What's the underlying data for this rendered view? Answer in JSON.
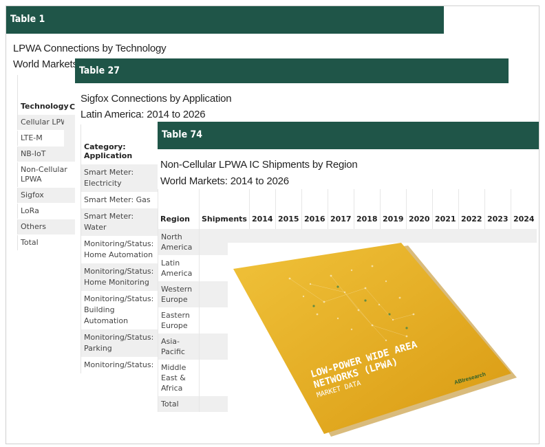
{
  "table1": {
    "label": "Table 1",
    "subtitle_line1": "LPWA Connections by Technology",
    "subtitle_line2": "World Markets",
    "header_col1": "Technology",
    "header_col2": "C",
    "rows": [
      "Cellular LPWA",
      "LTE-M",
      "NB-IoT",
      "Non-Cellular LPWA",
      "Sigfox",
      "LoRa",
      "Others",
      "Total"
    ]
  },
  "table27": {
    "label": "Table 27",
    "subtitle_line1": "Sigfox Connections by Application",
    "subtitle_line2": "Latin America: 2014 to 2026",
    "header": "Category: Application",
    "rows": [
      "Smart Meter: Electricity",
      "Smart Meter: Gas",
      "Smart Meter: Water",
      "Monitoring/Status: Home Automation",
      "Monitoring/Status: Home Monitoring",
      "Monitoring/Status: Building Automation",
      "Monitoring/Status: Parking",
      "Monitoring/Status:"
    ]
  },
  "table74": {
    "label": "Table 74",
    "subtitle_line1": "Non-Cellular LPWA IC Shipments by Region",
    "subtitle_line2": "World Markets: 2014 to 2026",
    "headers": [
      "Region",
      "Shipments",
      "2014",
      "2015",
      "2016",
      "2017",
      "2018",
      "2019",
      "2020",
      "2021",
      "2022",
      "2023",
      "2024"
    ],
    "rows": [
      "North America",
      "Latin America",
      "Western Europe",
      "Eastern Europe",
      "Asia-Pacific",
      "Middle East & Africa",
      "Total"
    ]
  },
  "cover": {
    "title_line1": "LOW-POWER WIDE AREA",
    "title_line2": "NETWORKS (LPWA)",
    "title_line3": "MARKET DATA",
    "brand": "ABIresearch",
    "color": "#e8b021"
  }
}
